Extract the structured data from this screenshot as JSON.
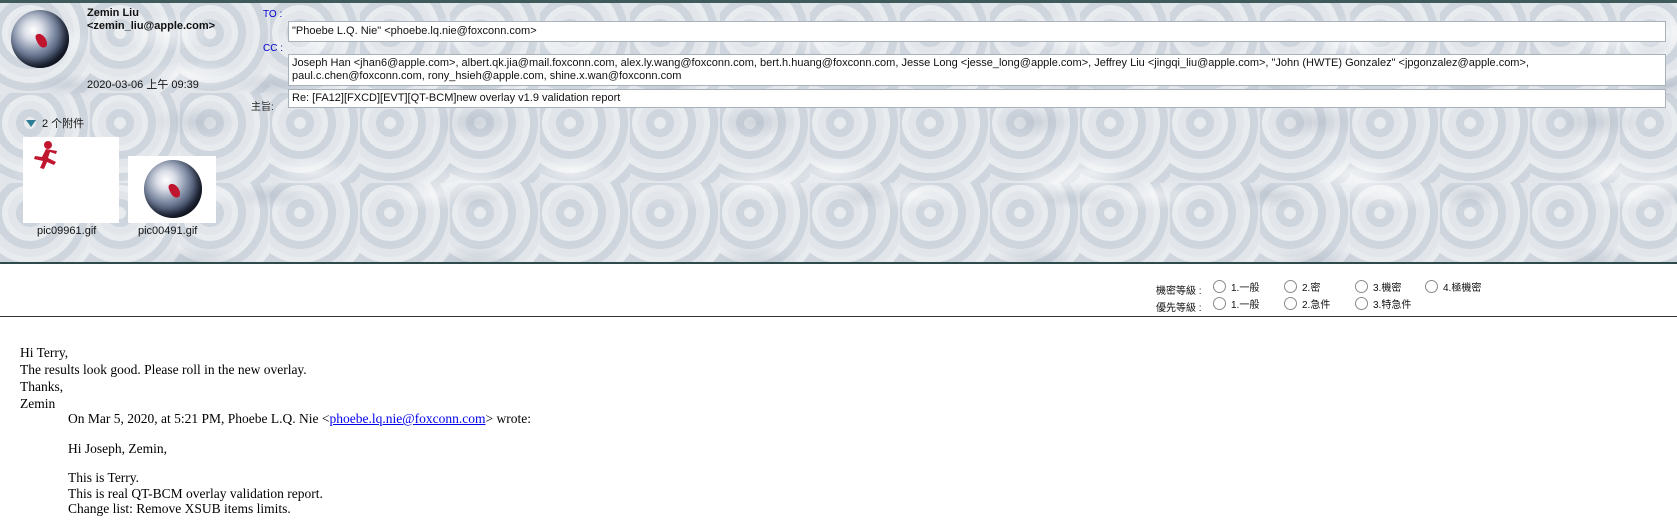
{
  "header": {
    "sender": {
      "name": "Zemin Liu",
      "email": "<zemin_liu@apple.com>",
      "date": "2020-03-06 上午 09:39"
    },
    "to": {
      "label": "TO :",
      "value": "\"Phoebe L.Q. Nie\" <phoebe.lq.nie@foxconn.com>"
    },
    "cc": {
      "label": "CC :",
      "line1": "Joseph Han <jhan6@apple.com>, albert.qk.jia@mail.foxconn.com, alex.ly.wang@foxconn.com, bert.h.huang@foxconn.com, Jesse Long <jesse_long@apple.com>, Jeffrey Liu <jingqi_liu@apple.com>, \"John (HWTE) Gonzalez\" <jpgonzalez@apple.com>,",
      "line2": "paul.c.chen@foxconn.com, rony_hsieh@apple.com, shine.x.wan@foxconn.com"
    },
    "subject": {
      "label": "主旨:",
      "value": "Re: [FA12][FXCD][EVT][QT-BCM]new overlay v1.9 validation report"
    },
    "attachments": {
      "toggle_label": "2 个附件",
      "items": [
        {
          "name": "pic09961.gif"
        },
        {
          "name": "pic00491.gif"
        }
      ]
    }
  },
  "classification": {
    "security_label": "機密等級 :",
    "security_options": [
      "1.一般",
      "2.密",
      "3.機密",
      "4.極機密"
    ],
    "priority_label": "優先等級 :",
    "priority_options": [
      "1.一般",
      "2.急件",
      "3.特急件"
    ]
  },
  "body": {
    "lines": [
      "Hi Terry,",
      "The results look good. Please roll in the new overlay.",
      "Thanks,",
      "Zemin"
    ],
    "quote_intro_prefix": "On Mar 5, 2020, at 5:21 PM, Phoebe L.Q. Nie <",
    "quote_intro_link": "phoebe.lq.nie@foxconn.com",
    "quote_intro_suffix": "> wrote:",
    "quote_greeting": "Hi Joseph, Zemin,",
    "quote_lines": [
      "This is Terry.",
      "This is real QT-BCM overlay validation report.",
      "Change list: Remove XSUB items limits."
    ]
  },
  "colors": {
    "header_border": "#3f5a5a",
    "field_label_blue": "#0000cc",
    "link": "#0000ee",
    "toggle_triangle": "#2e7d96"
  }
}
